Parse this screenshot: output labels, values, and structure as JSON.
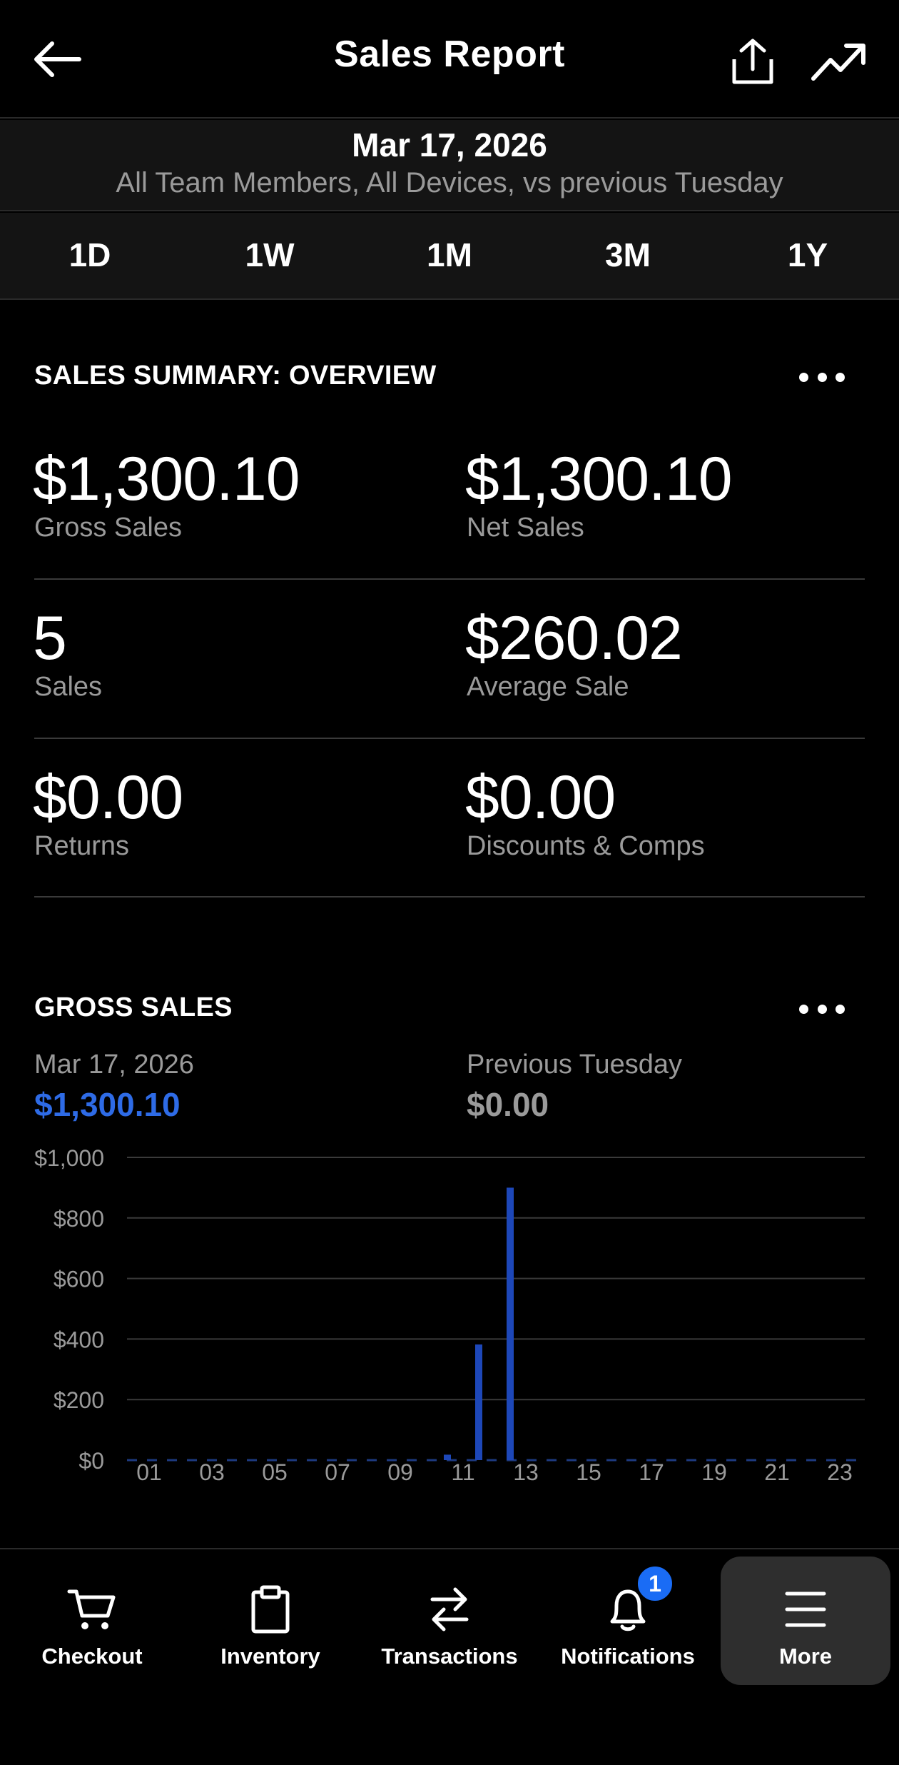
{
  "header": {
    "title": "Sales Report"
  },
  "date_band": {
    "date": "Mar 17, 2026",
    "subtitle": "All Team Members, All Devices, vs previous Tuesday"
  },
  "tabs": [
    "1D",
    "1W",
    "1M",
    "3M",
    "1Y"
  ],
  "summary": {
    "title": "SALES SUMMARY: OVERVIEW",
    "metrics": [
      {
        "value": "$1,300.10",
        "label": "Gross Sales"
      },
      {
        "value": "$1,300.10",
        "label": "Net Sales"
      },
      {
        "value": "5",
        "label": "Sales"
      },
      {
        "value": "$260.02",
        "label": "Average Sale"
      },
      {
        "value": "$0.00",
        "label": "Returns"
      },
      {
        "value": "$0.00",
        "label": "Discounts & Comps"
      }
    ]
  },
  "gross_sales": {
    "title": "GROSS SALES",
    "current_label": "Mar 17, 2026",
    "current_value": "$1,300.10",
    "previous_label": "Previous Tuesday",
    "previous_value": "$0.00"
  },
  "chart_data": {
    "type": "bar",
    "x": [
      0,
      1,
      2,
      3,
      4,
      5,
      6,
      7,
      8,
      9,
      10,
      11,
      12,
      13,
      14,
      15,
      16,
      17,
      18,
      19,
      20,
      21,
      22,
      23
    ],
    "x_tick_labels": [
      "01",
      "03",
      "05",
      "07",
      "09",
      "11",
      "13",
      "15",
      "17",
      "19",
      "21",
      "23"
    ],
    "x_tick_values": [
      1,
      3,
      5,
      7,
      9,
      11,
      13,
      15,
      17,
      19,
      21,
      23
    ],
    "values": [
      0,
      0,
      0,
      0,
      0,
      0,
      0,
      0,
      0,
      0,
      18,
      382,
      900,
      0,
      0,
      0,
      0,
      0,
      0,
      0,
      0,
      0,
      0,
      0
    ],
    "y_tick_labels": [
      "$0",
      "$200",
      "$400",
      "$600",
      "$800",
      "$1,000"
    ],
    "y_tick_values": [
      0,
      200,
      400,
      600,
      800,
      1000
    ],
    "ylim": [
      0,
      1000
    ],
    "grid": true,
    "bar_color": "#1d47b8",
    "baseline_color": "#1d3a80"
  },
  "nav": [
    {
      "label": "Checkout",
      "icon": "cart-icon"
    },
    {
      "label": "Inventory",
      "icon": "clipboard-icon"
    },
    {
      "label": "Transactions",
      "icon": "swap-arrows-icon"
    },
    {
      "label": "Notifications",
      "icon": "bell-icon"
    },
    {
      "label": "More",
      "icon": "hamburger-icon"
    }
  ],
  "notifications_badge": "1",
  "colors": {
    "accent_blue": "#1a6cf5",
    "gross_sales_value": "#2e6be6",
    "muted_text": "#9a9a9a"
  }
}
